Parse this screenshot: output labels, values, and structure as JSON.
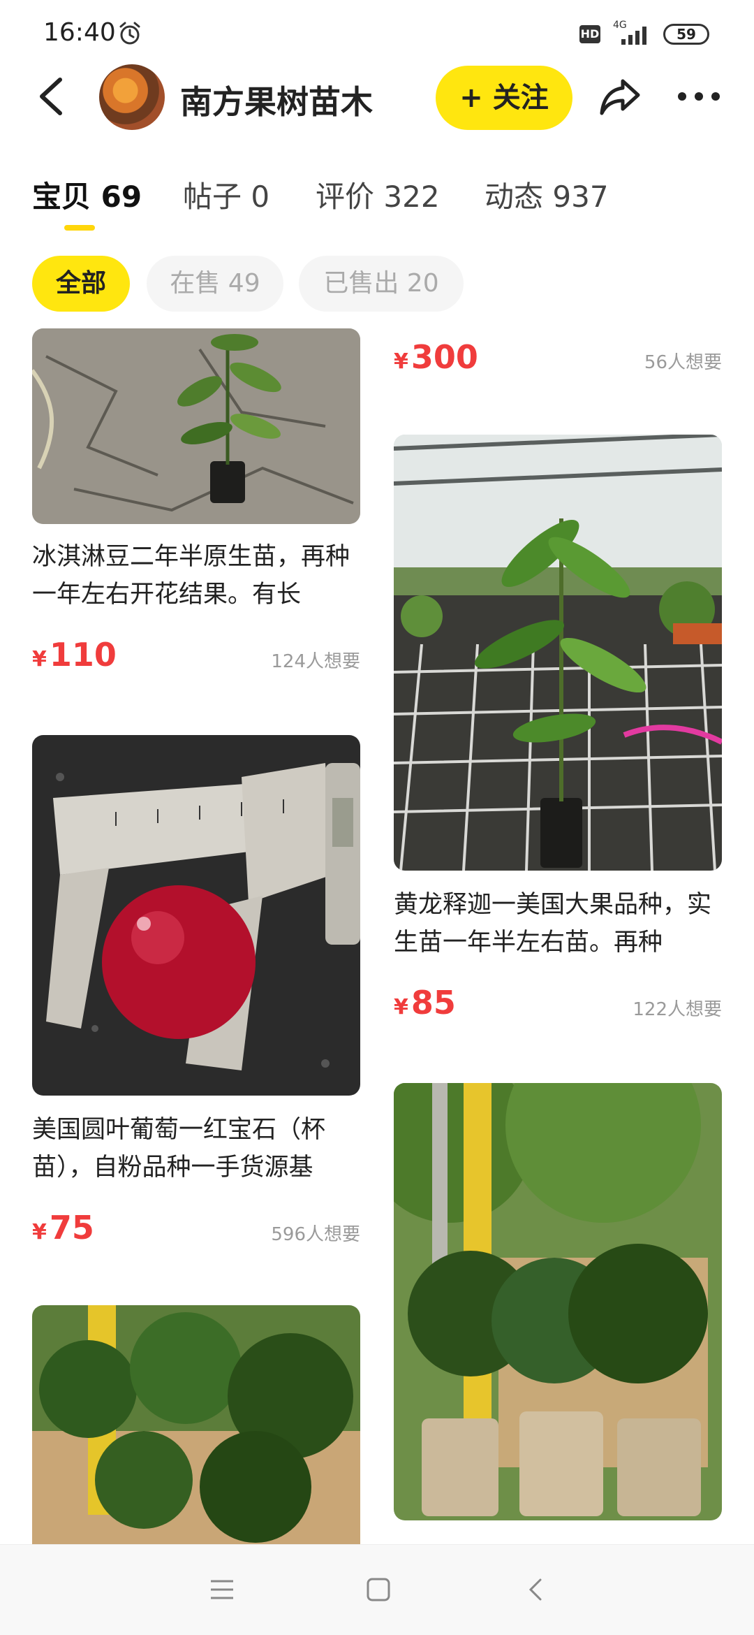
{
  "status_bar": {
    "time": "16:40",
    "hd": "HD",
    "network": "4G",
    "battery": "59",
    "icons": [
      "alarm-icon",
      "signal-icon",
      "battery-icon"
    ]
  },
  "header": {
    "shop_name": "南方果树苗木",
    "follow_label": "+ 关注",
    "icons": [
      "back-icon",
      "shop-avatar",
      "share-icon",
      "more-icon"
    ],
    "accent_color": "#ffe60f"
  },
  "tabs": [
    {
      "label": "宝贝",
      "count": "69"
    },
    {
      "label": "帖子",
      "count": "0"
    },
    {
      "label": "评价",
      "count": "322"
    },
    {
      "label": "动态",
      "count": "937"
    }
  ],
  "filters": [
    {
      "label": "全部"
    },
    {
      "label": "在售 49"
    },
    {
      "label": "已售出 20"
    }
  ],
  "products": [
    {
      "title": "冰淇淋豆二年半原生苗，再种一年左右开花结果。有长",
      "price": "110",
      "currency": "¥",
      "wants": "124人想要"
    },
    {
      "title": "美国圆叶葡萄一红宝石（杯苗），自粉品种一手货源基",
      "price": "75",
      "currency": "¥",
      "wants": "596人想要"
    },
    {
      "title": "",
      "price": "300",
      "currency": "¥",
      "wants": "56人想要"
    },
    {
      "title": "黄龙释迦一美国大果品种，实生苗一年半左右苗。再种",
      "price": "85",
      "currency": "¥",
      "wants": "122人想要"
    },
    {
      "title": "",
      "price": "",
      "currency": "",
      "wants": ""
    }
  ],
  "price_color": "#f03c3c",
  "nav": {
    "icons": [
      "menu-icon",
      "home-icon",
      "back-nav-icon"
    ]
  }
}
